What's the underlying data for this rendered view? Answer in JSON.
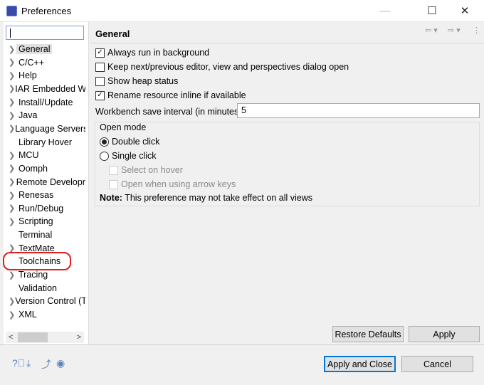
{
  "window": {
    "title": "Preferences",
    "minimize": "—",
    "maximize": "☐",
    "close": "✕"
  },
  "sidebar": {
    "filter_value": "",
    "items": [
      {
        "label": "General",
        "expandable": true,
        "selected": true
      },
      {
        "label": "C/C++",
        "expandable": true
      },
      {
        "label": "Help",
        "expandable": true
      },
      {
        "label": "IAR Embedded W",
        "expandable": true
      },
      {
        "label": "Install/Update",
        "expandable": true
      },
      {
        "label": "Java",
        "expandable": true
      },
      {
        "label": "Language Servers",
        "expandable": true
      },
      {
        "label": "Library Hover",
        "expandable": false
      },
      {
        "label": "MCU",
        "expandable": true
      },
      {
        "label": "Oomph",
        "expandable": true
      },
      {
        "label": "Remote Developr",
        "expandable": true
      },
      {
        "label": "Renesas",
        "expandable": true
      },
      {
        "label": "Run/Debug",
        "expandable": true
      },
      {
        "label": "Scripting",
        "expandable": true
      },
      {
        "label": "Terminal",
        "expandable": false
      },
      {
        "label": "TextMate",
        "expandable": true
      },
      {
        "label": "Toolchains",
        "expandable": false,
        "annotated": true
      },
      {
        "label": "Tracing",
        "expandable": true
      },
      {
        "label": "Validation",
        "expandable": false
      },
      {
        "label": "Version Control (T",
        "expandable": true
      },
      {
        "label": "XML",
        "expandable": true
      }
    ]
  },
  "main": {
    "title": "General",
    "options": [
      {
        "label": "Always run in background",
        "checked": true
      },
      {
        "label": "Keep next/previous editor, view and perspectives dialog open",
        "checked": false
      },
      {
        "label": "Show heap status",
        "checked": false
      },
      {
        "label": "Rename resource inline if available",
        "checked": true
      }
    ],
    "interval_label": "Workbench save interval (in minutes):",
    "interval_value": "5",
    "open_mode": {
      "label": "Open mode",
      "double": "Double click",
      "single": "Single click",
      "selected": "double",
      "hover": "Select on hover",
      "arrow": "Open when using arrow keys"
    },
    "note_bold": "Note:",
    "note_text": " This preference may not take effect on all views"
  },
  "buttons": {
    "restore": "Restore Defaults",
    "apply": "Apply",
    "apply_close": "Apply and Close",
    "cancel": "Cancel"
  },
  "colors": {
    "annotation": "#e02020",
    "accent": "#0078d7"
  }
}
